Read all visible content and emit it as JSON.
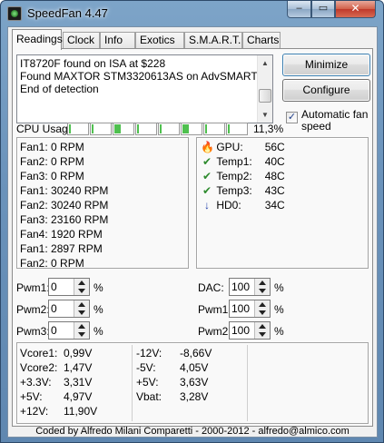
{
  "window": {
    "title": "SpeedFan 4.47",
    "controls": {
      "minimize": "–",
      "maximize": "▭",
      "close": "✕"
    }
  },
  "tabs": [
    "Readings",
    "Clock",
    "Info",
    "Exotics",
    "S.M.A.R.T.",
    "Charts"
  ],
  "log": {
    "lines": [
      "IT8720F found on ISA at $228",
      "Found MAXTOR STM3320613AS on AdvSMART",
      "End of detection"
    ]
  },
  "buttons": {
    "minimize": "Minimize",
    "configure": "Configure"
  },
  "auto_fan": {
    "label": "Automatic fan speed",
    "checked": true,
    "mark": "✓"
  },
  "cpu": {
    "label": "CPU Usage",
    "value": "11,3%",
    "core_fill_fractions": [
      0.05,
      0.05,
      0.35,
      0.05,
      0.05,
      0.35,
      0.05,
      0.05
    ]
  },
  "fans": [
    "Fan1: 0 RPM",
    "Fan2: 0 RPM",
    "Fan3: 0 RPM",
    "Fan1: 30240 RPM",
    "Fan2: 30240 RPM",
    "Fan3: 23160 RPM",
    "Fan4: 1920 RPM",
    "Fan1: 2897 RPM",
    "Fan2: 0 RPM"
  ],
  "temps": [
    {
      "icon": "flame-icon",
      "glyph": "🔥",
      "color": "#e05a10",
      "label": "GPU:",
      "value": "56C"
    },
    {
      "icon": "checkmark-icon",
      "glyph": "✔",
      "color": "#2e8b2e",
      "label": "Temp1:",
      "value": "40C"
    },
    {
      "icon": "checkmark-icon",
      "glyph": "✔",
      "color": "#2e8b2e",
      "label": "Temp2:",
      "value": "48C"
    },
    {
      "icon": "checkmark-icon",
      "glyph": "✔",
      "color": "#2e8b2e",
      "label": "Temp3:",
      "value": "43C"
    },
    {
      "icon": "arrow-down-icon",
      "glyph": "↓",
      "color": "#1f3fa8",
      "label": "HD0:",
      "value": "34C"
    }
  ],
  "pwm_left": [
    {
      "label": "Pwm1:",
      "value": "0",
      "unit": "%"
    },
    {
      "label": "Pwm2:",
      "value": "0",
      "unit": "%"
    },
    {
      "label": "Pwm3:",
      "value": "0",
      "unit": "%"
    }
  ],
  "pwm_right": [
    {
      "label": "DAC:",
      "value": "100",
      "unit": "%"
    },
    {
      "label": "Pwm1:",
      "value": "100",
      "unit": "%"
    },
    {
      "label": "Pwm2:",
      "value": "100",
      "unit": "%"
    }
  ],
  "voltages_col1": [
    {
      "label": "Vcore1:",
      "value": "0,99V"
    },
    {
      "label": "Vcore2:",
      "value": "1,47V"
    },
    {
      "label": "+3.3V:",
      "value": "3,31V"
    },
    {
      "label": "+5V:",
      "value": "4,97V"
    },
    {
      "label": "+12V:",
      "value": "11,90V"
    }
  ],
  "voltages_col2": [
    {
      "label": "-12V:",
      "value": "-8,66V"
    },
    {
      "label": "-5V:",
      "value": "4,05V"
    },
    {
      "label": "+5V:",
      "value": "3,63V"
    },
    {
      "label": "Vbat:",
      "value": "3,28V"
    }
  ],
  "footer": "Coded by Alfredo Milani Comparetti - 2000-2012 - alfredo@almico.com"
}
